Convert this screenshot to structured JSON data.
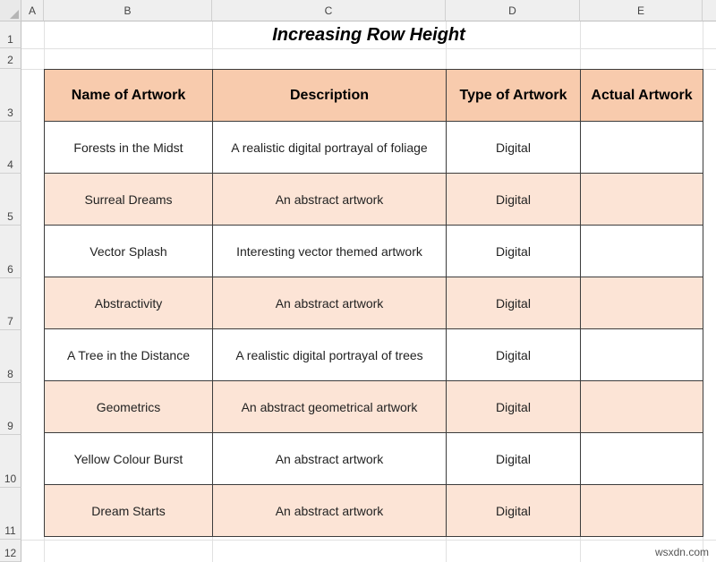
{
  "sheet": {
    "columns": [
      "A",
      "B",
      "C",
      "D",
      "E"
    ],
    "rows": [
      "1",
      "2",
      "3",
      "4",
      "5",
      "6",
      "7",
      "8",
      "9",
      "10",
      "11",
      "12"
    ],
    "title": "Increasing Row Height"
  },
  "table": {
    "headers": [
      "Name of Artwork",
      "Description",
      "Type of Artwork",
      "Actual Artwork"
    ],
    "rows": [
      {
        "name": "Forests in the Midst",
        "description": "A realistic digital portrayal of  foliage",
        "type": "Digital",
        "artwork": ""
      },
      {
        "name": "Surreal Dreams",
        "description": "An abstract artwork",
        "type": "Digital",
        "artwork": ""
      },
      {
        "name": "Vector Splash",
        "description": "Interesting vector themed artwork",
        "type": "Digital",
        "artwork": ""
      },
      {
        "name": "Abstractivity",
        "description": "An abstract artwork",
        "type": "Digital",
        "artwork": ""
      },
      {
        "name": "A Tree in the Distance",
        "description": "A realistic digital portrayal of trees",
        "type": "Digital",
        "artwork": ""
      },
      {
        "name": "Geometrics",
        "description": "An abstract geometrical artwork",
        "type": "Digital",
        "artwork": ""
      },
      {
        "name": "Yellow Colour Burst",
        "description": "An abstract artwork",
        "type": "Digital",
        "artwork": ""
      },
      {
        "name": "Dream Starts",
        "description": "An abstract artwork",
        "type": "Digital",
        "artwork": ""
      }
    ]
  },
  "colors": {
    "header_fill": "#f8cbad",
    "band_fill": "#fce4d6"
  },
  "watermark": "wsxdn.com"
}
